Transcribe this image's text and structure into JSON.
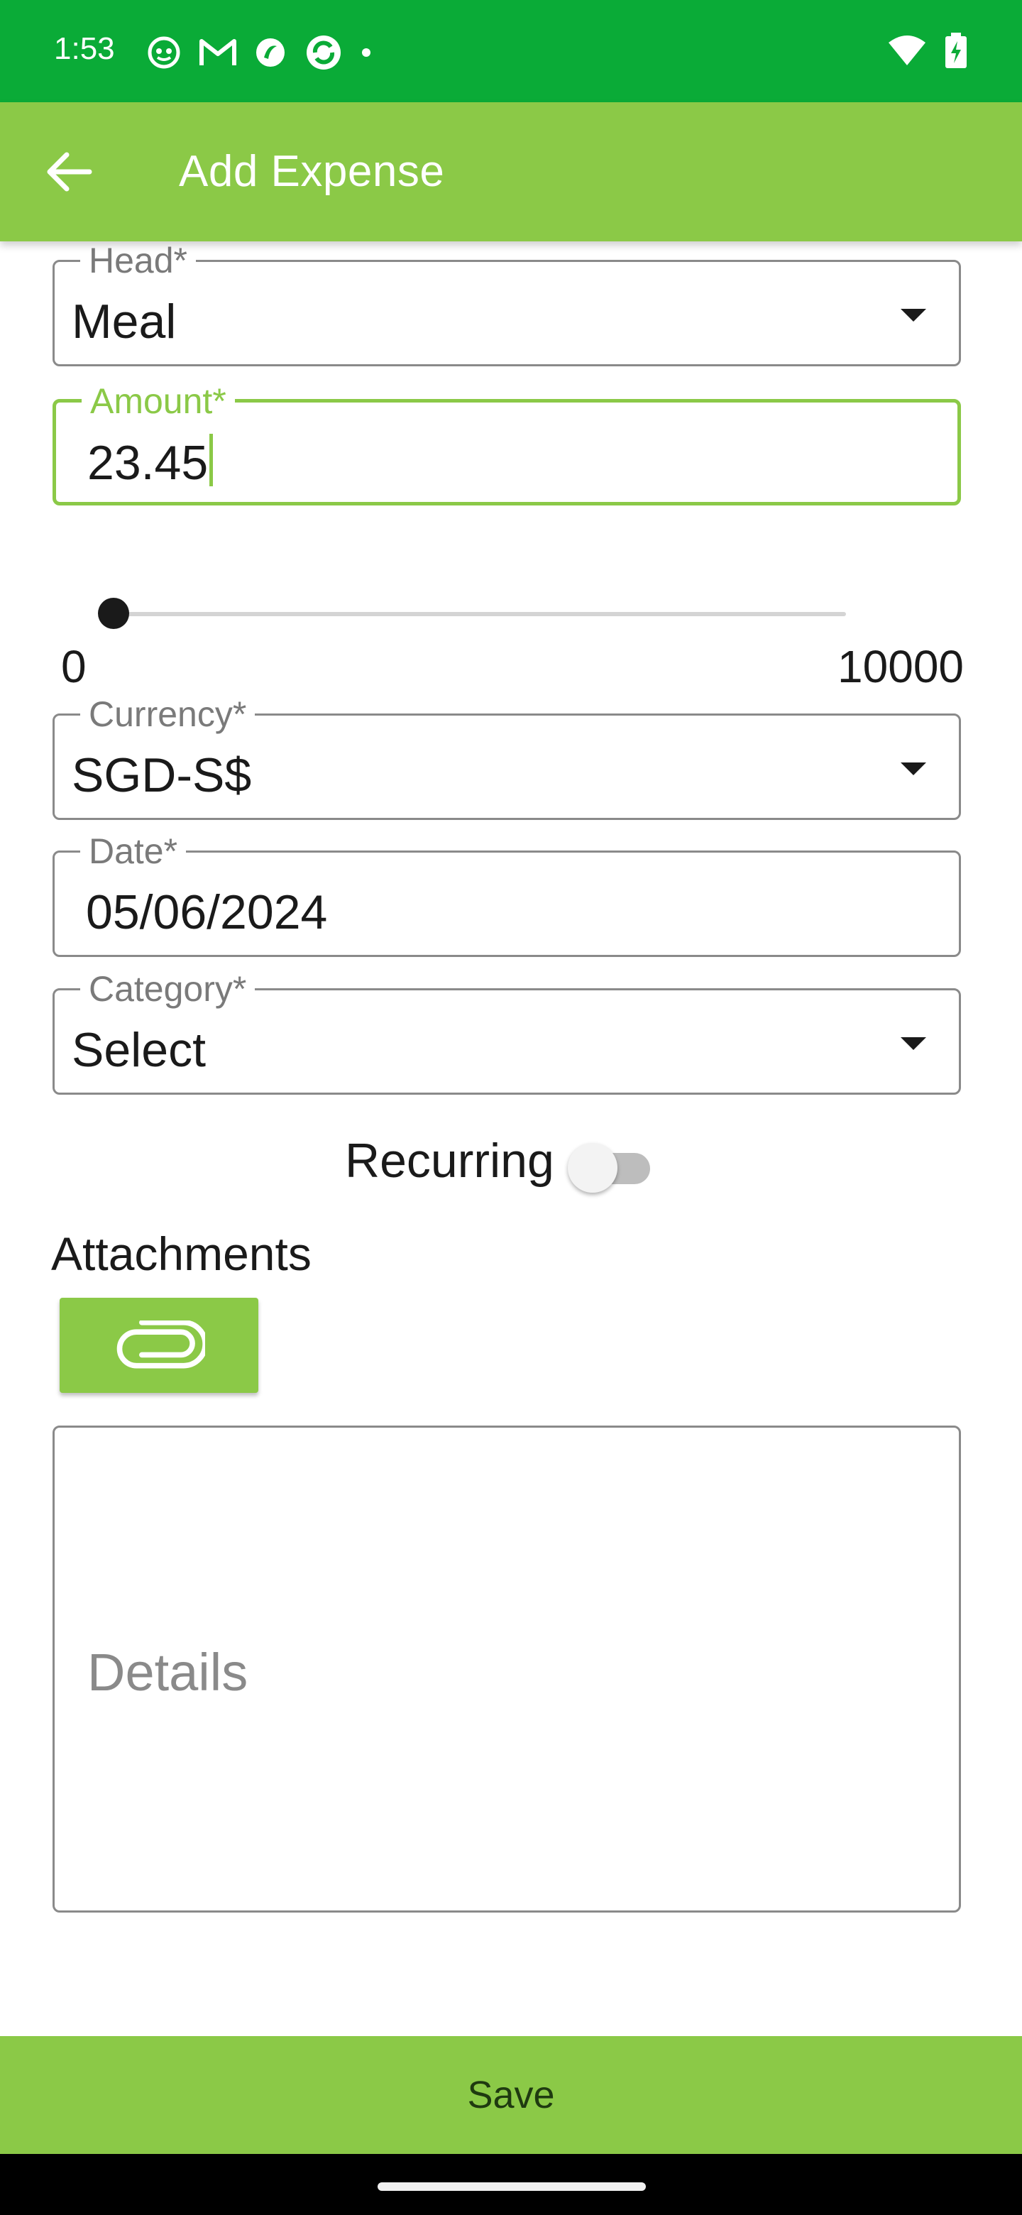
{
  "status_bar": {
    "time": "1:53",
    "left_icons": [
      "notification-app-icon",
      "gmail-icon",
      "app-icon",
      "sync-icon",
      "dot-icon"
    ],
    "right_icons": [
      "wifi-icon",
      "battery-charging-icon"
    ]
  },
  "app_bar": {
    "title": "Add Expense",
    "back_icon": "arrow-left-icon"
  },
  "form": {
    "head": {
      "label": "Head*",
      "value": "Meal"
    },
    "amount": {
      "label": "Amount*",
      "value": "23.45"
    },
    "slider": {
      "min": "0",
      "max": "10000",
      "value": 23.45
    },
    "currency": {
      "label": "Currency*",
      "value": "SGD-S$"
    },
    "date": {
      "label": "Date*",
      "value": "05/06/2024"
    },
    "category": {
      "label": "Category*",
      "value": "Select"
    },
    "recurring": {
      "label": "Recurring",
      "checked": false
    },
    "attachments": {
      "title": "Attachments",
      "icon": "paperclip-icon"
    },
    "details": {
      "placeholder": "Details"
    }
  },
  "footer": {
    "save_label": "Save"
  },
  "colors": {
    "status_bar": "#0aab37",
    "accent": "#8bc947",
    "border": "#8a8a8a"
  }
}
